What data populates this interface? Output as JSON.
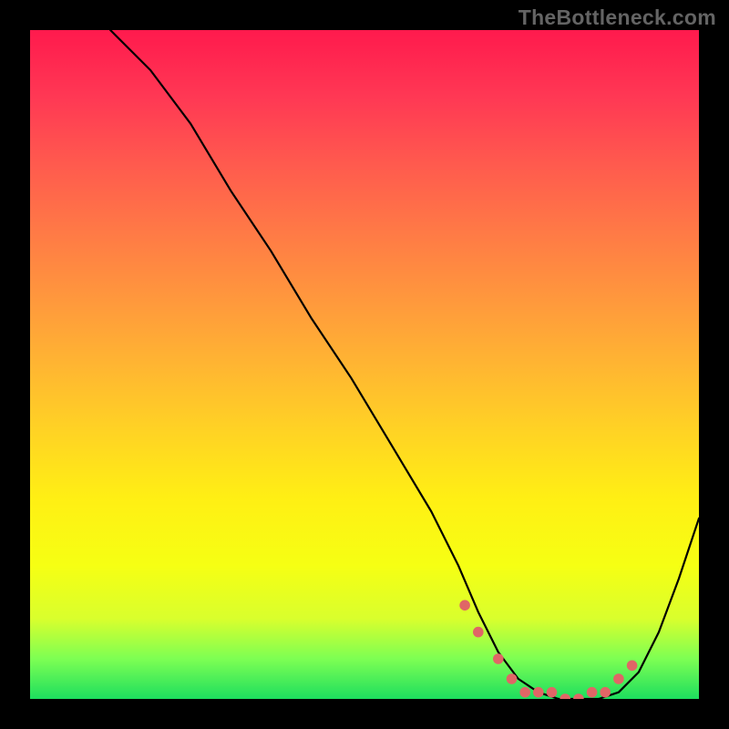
{
  "watermark": "TheBottleneck.com",
  "chart_data": {
    "type": "line",
    "title": "",
    "xlabel": "",
    "ylabel": "",
    "xlim": [
      0,
      100
    ],
    "ylim": [
      0,
      100
    ],
    "series": [
      {
        "name": "curve",
        "x": [
          12,
          18,
          24,
          30,
          36,
          42,
          48,
          54,
          60,
          64,
          67,
          70,
          73,
          76,
          79,
          82,
          85,
          88,
          91,
          94,
          97,
          100
        ],
        "values": [
          100,
          94,
          86,
          76,
          67,
          57,
          48,
          38,
          28,
          20,
          13,
          7,
          3,
          1,
          0,
          0,
          0,
          1,
          4,
          10,
          18,
          27
        ]
      }
    ],
    "markers": {
      "name": "bottom-markers",
      "x": [
        65,
        67,
        70,
        72,
        74,
        76,
        78,
        80,
        82,
        84,
        86,
        88,
        90
      ],
      "values": [
        14,
        10,
        6,
        3,
        1,
        1,
        1,
        0,
        0,
        1,
        1,
        3,
        5
      ]
    },
    "colors": {
      "curve": "#000000",
      "markers": "#e06666",
      "gradient_top": "#ff1a4d",
      "gradient_bottom": "#1dde5e"
    }
  }
}
